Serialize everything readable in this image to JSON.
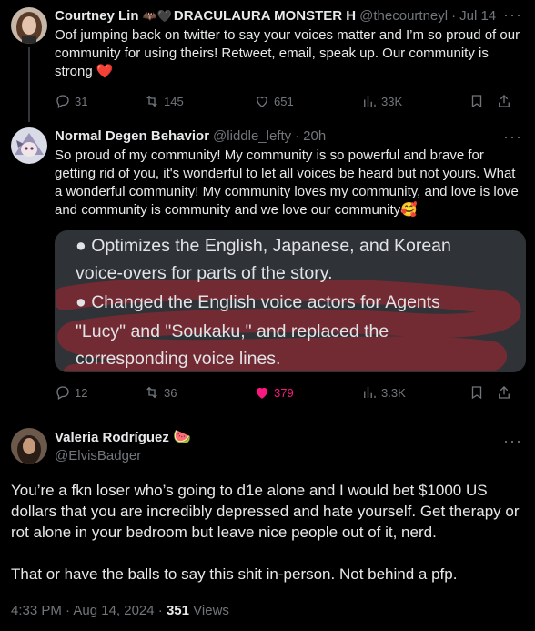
{
  "tweet1": {
    "name": "Courtney Lin",
    "name_extra": "DRACULAURA MONSTER H",
    "handle": "@thecourtneyl",
    "time": "Jul 14",
    "text": "Oof jumping back on twitter to say your voices matter and I’m so proud of our community for using theirs! Retweet, email, speak up. Our community is strong",
    "emoji": "❤️",
    "replies": "31",
    "reposts": "145",
    "likes": "651",
    "views": "33K"
  },
  "tweet2": {
    "name": "Normal Degen Behavior",
    "handle": "@liddle_lefty",
    "time": "20h",
    "text": "So proud of my community! My community is so powerful and brave for getting rid of you, it's wonderful to let all voices be heard but not yours. What a wonderful community! My community loves my community, and love is love and community is community and we love our community🥰",
    "media": {
      "line1": "● Optimizes the English, Japanese, and Korean",
      "line2": "voice-overs for parts of the story.",
      "line3": "● Changed the English voice actors for Agents",
      "line4": "\"Lucy\" and \"Soukaku,\" and replaced the",
      "line5": "corresponding voice lines."
    },
    "replies": "12",
    "reposts": "36",
    "likes": "379",
    "views": "3.3K"
  },
  "main": {
    "name": "Valeria Rodríguez",
    "name_emoji": "🍉",
    "handle": "@ElvisBadger",
    "para1": "You’re a fkn loser who’s going to d1e alone and I would bet $1000 US dollars that you are incredibly depressed and hate yourself. Get therapy or rot alone in your bedroom but leave nice people out of it, nerd.",
    "para2": "That or have the balls to say this shit in-person. Not behind a pfp.",
    "time": "4:33 PM · Aug 14, 2024 ·",
    "views_count": "351",
    "views_label": "Views"
  },
  "colors": {
    "background": "#000000",
    "text": "#e7e9ea",
    "muted": "#71767b",
    "like_active": "#f91880",
    "media_bg": "#2f3237"
  }
}
